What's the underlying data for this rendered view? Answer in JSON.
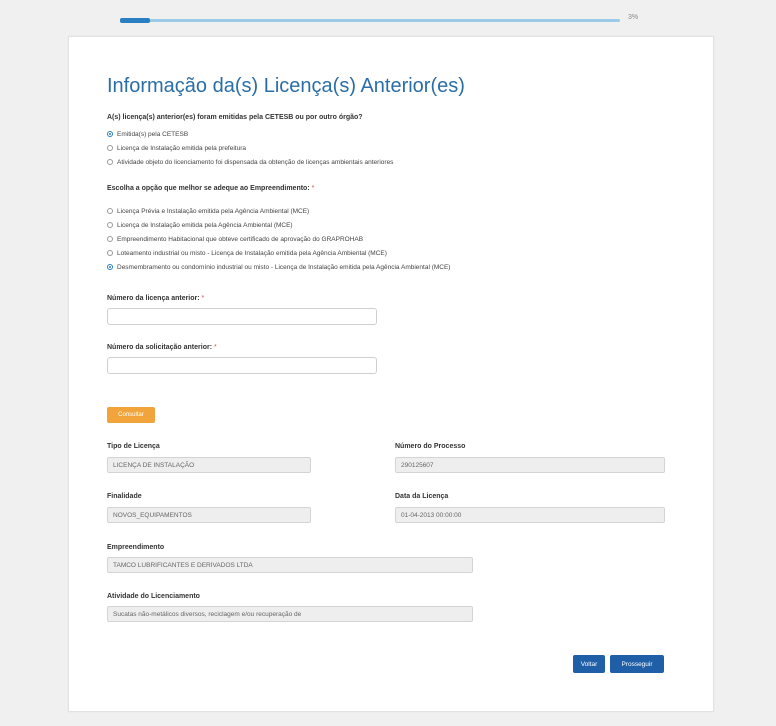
{
  "progress": {
    "percent_label": "3%",
    "value": 0.03
  },
  "title": "Informação da(s) Licença(s) Anterior(es)",
  "question1": {
    "label": "A(s) licença(s) anterior(es) foram emitidas pela CETESB ou por outro órgão?",
    "options": [
      {
        "label": "Emitida(s) pela CETESB",
        "checked": true
      },
      {
        "label": "Licença de Instalação emitida pela prefeitura",
        "checked": false
      },
      {
        "label": "Atividade objeto do licenciamento foi dispensada da obtenção de licenças ambientais anteriores",
        "checked": false
      }
    ]
  },
  "question2": {
    "label": "Escolha a opção que melhor se adeque ao Empreendimento:",
    "required_mark": "*",
    "options": [
      {
        "label": "Licença Prévia e Instalação emitida pela Agência Ambiental (MCE)",
        "checked": false
      },
      {
        "label": "Licença de Instalação emitida pela Agência Ambiental (MCE)",
        "checked": false
      },
      {
        "label": "Empreendimento Habitacional que obteve certificado de aprovação do GRAPROHAB",
        "checked": false
      },
      {
        "label": "Loteamento industrial ou misto - Licença de Instalação emitida pela Agência Ambiental (MCE)",
        "checked": false
      },
      {
        "label": "Desmembramento ou condomínio industrial ou misto - Licença de Instalação emitida pela Agência Ambiental (MCE)",
        "checked": true
      }
    ]
  },
  "fields": {
    "licenca_anterior": {
      "label": "Número da licença anterior:",
      "required_mark": "*",
      "value": ""
    },
    "solicitacao_anterior": {
      "label": "Número da solicitação anterior:",
      "required_mark": "*",
      "value": ""
    }
  },
  "buttons": {
    "consultar": "Consultar",
    "voltar": "Voltar",
    "prosseguir": "Prosseguir"
  },
  "result": {
    "tipo_licenca": {
      "label": "Tipo de Licença",
      "value": "LICENÇA DE INSTALAÇÃO"
    },
    "numero_processo": {
      "label": "Número do Processo",
      "value": "290125607"
    },
    "finalidade": {
      "label": "Finalidade",
      "value": "NOVOS_EQUIPAMENTOS"
    },
    "data_licenca": {
      "label": "Data da Licença",
      "value": "01-04-2013 00:00:00"
    },
    "empreendimento": {
      "label": "Empreendimento",
      "value": "TAMCO LUBRIFICANTES E DERIVADOS LTDA"
    },
    "atividade": {
      "label": "Atividade do Licenciamento",
      "value": "Sucatas não-metálicos diversos, reciclagem e/ou recuperação de"
    }
  },
  "colors": {
    "accent": "#2a7ec2",
    "title": "#2a6ea8",
    "consultar": "#f0a43a",
    "primary_button": "#1f5fa8"
  }
}
